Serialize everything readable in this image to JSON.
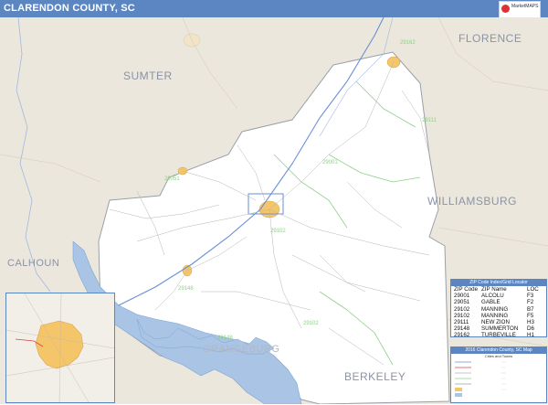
{
  "title": "CLARENDON COUNTY, SC",
  "logo": {
    "name": "MarketMAPS",
    "icon": "globe-logo-icon"
  },
  "county_labels": [
    "SUMTER",
    "FLORENCE",
    "WILLIAMSBURG",
    "CALHOUN",
    "BERKELEY",
    "ORANGEBURG"
  ],
  "zip_labels": [
    "29001",
    "29102",
    "29111",
    "29148",
    "29162",
    "29051",
    "29148",
    "29102"
  ],
  "zip_table": {
    "title": "ZIP Code Index/Grid Locator",
    "headers": [
      "ZIP Code",
      "ZIP Name",
      "LOC"
    ],
    "rows": [
      [
        "29001",
        "ALCOLU",
        "F3"
      ],
      [
        "29051",
        "GABLE",
        "F2"
      ],
      [
        "29102",
        "MANNING",
        "B7"
      ],
      [
        "29102",
        "MANNING",
        "F5"
      ],
      [
        "29111",
        "NEW ZION",
        "H3"
      ],
      [
        "29148",
        "SUMMERTON",
        "D6"
      ],
      [
        "29162",
        "TURBEVILLE",
        "H1"
      ]
    ]
  },
  "legend": {
    "title": "2016 Clarendon County, SC Map",
    "subtitle": "Cities and Towns"
  },
  "colors": {
    "title_bar": "#5b86c2",
    "county_fill": "#ffffff",
    "surrounding_fill": "#ece7dc",
    "water": "#a9c4e4",
    "urban": "#f5c56a",
    "zip_boundary": "#8fcf8a",
    "county_boundary": "#9aa0a8",
    "road": "#b0b0b0",
    "interstate": "#6a8fd6"
  }
}
